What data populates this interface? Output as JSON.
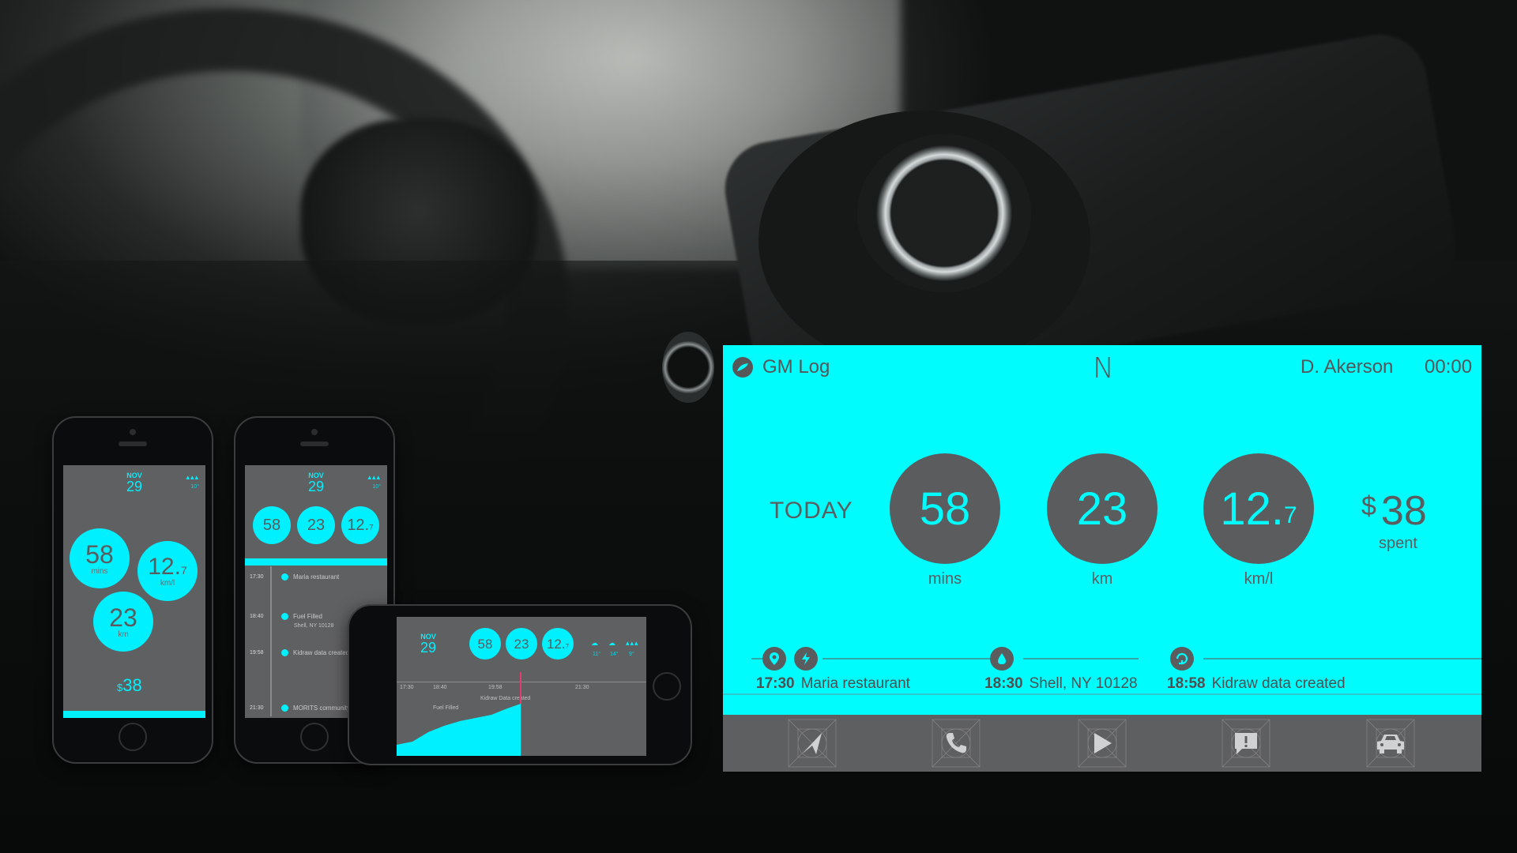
{
  "dashboard": {
    "app_name": "GM Log",
    "compass": "N",
    "user": "D. Akerson",
    "time": "00:00",
    "today_label": "TODAY",
    "stats": [
      {
        "value": "58",
        "sub": "",
        "unit": "mins"
      },
      {
        "value": "23",
        "sub": "",
        "unit": "km"
      },
      {
        "value": "12.",
        "sub": "7",
        "unit": "km/l"
      }
    ],
    "spent": {
      "currency": "$",
      "value": "38",
      "label": "spent"
    },
    "events": [
      {
        "time": "17:30",
        "label": "Maria restaurant",
        "icons": [
          "location-pin-icon",
          "lightning-icon"
        ]
      },
      {
        "time": "18:30",
        "label": "Shell, NY 10128",
        "icons": [
          "fuel-drop-icon"
        ]
      },
      {
        "time": "18:58",
        "label": "Kidraw data created",
        "icons": [
          "sync-icon"
        ]
      }
    ],
    "nav": [
      "navigation-arrow-icon",
      "phone-icon",
      "play-icon",
      "message-alert-icon",
      "car-icon"
    ]
  },
  "phone1": {
    "month": "NOV",
    "day": "29",
    "weather": "▴▴▴",
    "temp": "10°",
    "mins": "58",
    "mins_unit": "mins",
    "kml": "12.",
    "kml_sub": "7",
    "kml_unit": "km/l",
    "km": "23",
    "km_unit": "km",
    "spent_cur": "$",
    "spent": "38"
  },
  "phone2": {
    "month": "NOV",
    "day": "29",
    "weather": "▴▴▴",
    "temp": "10°",
    "stat1": "58",
    "stat2": "23",
    "stat3": "12.",
    "stat3_sub": "7",
    "timeline": [
      {
        "time": "17:30",
        "label": "Maria restaurant"
      },
      {
        "time": "18:40",
        "label": "Fuel Filled"
      },
      {
        "time": "19:58",
        "label": "Kidraw data created"
      },
      {
        "time": "21:30",
        "label": "MORITS community"
      }
    ],
    "sub_label": "Shell, NY 10128"
  },
  "phone3": {
    "month": "NOV",
    "day": "29",
    "stat1": "58",
    "stat2": "23",
    "stat3": "12.",
    "stat3_sub": "7",
    "weather": [
      {
        "icon": "cloud-icon",
        "temp": "11°"
      },
      {
        "icon": "cloud-icon",
        "temp": "14°"
      },
      {
        "icon": "rain-icon",
        "temp": "9°"
      }
    ],
    "times": [
      "17:30",
      "18:40",
      "19:58",
      "21:30"
    ],
    "chart_label": "Kidraw Data created",
    "chart_label2": "Fuel Filled"
  }
}
